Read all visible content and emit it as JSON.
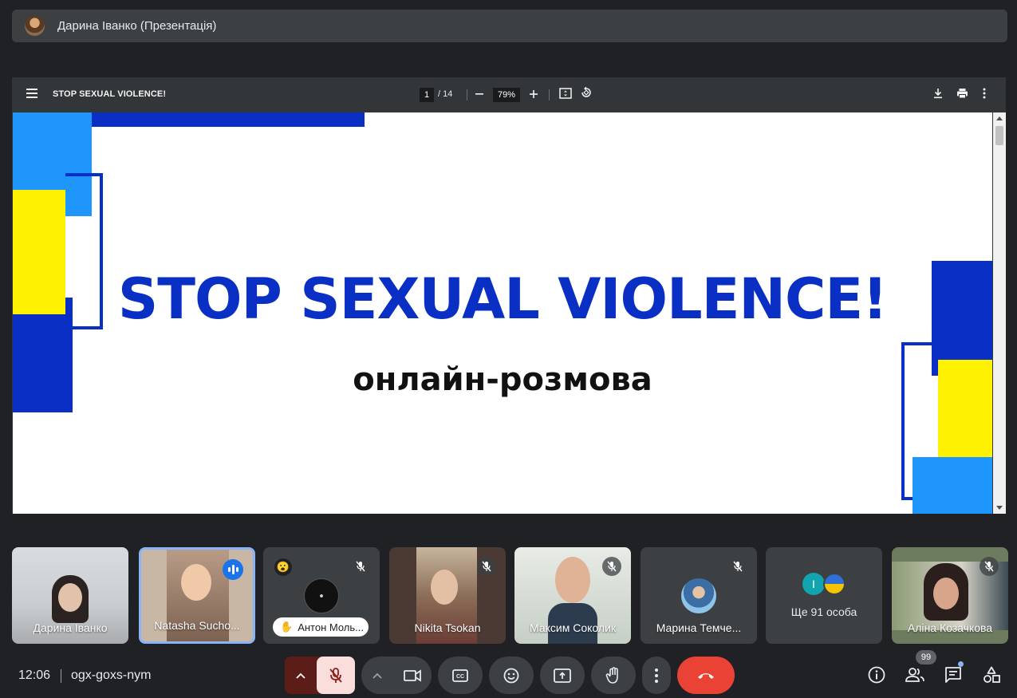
{
  "presenter": {
    "name": "Дарина Іванко (Презентація)"
  },
  "pdf": {
    "title": "STOP SEXUAL VIOLENCE!",
    "page_current": "1",
    "page_total": "/ 14",
    "zoom": "79%",
    "slide_title": "STOP SEXUAL VIOLENCE!",
    "slide_subtitle": "онлайн-розмова"
  },
  "participants": [
    {
      "name": "Дарина Іванко",
      "mic": "on"
    },
    {
      "name": "Natasha Sucho...",
      "mic": "speaking"
    },
    {
      "name": "Антон Моль...",
      "mic": "off",
      "reaction": "😮",
      "hand_raised": true
    },
    {
      "name": "Nikita Tsokan",
      "mic": "off"
    },
    {
      "name": "Максим Соколик",
      "mic": "off"
    },
    {
      "name": "Марина Темче...",
      "mic": "off"
    },
    {
      "name": "Ще 91 особа",
      "initial": "I"
    },
    {
      "name": "Аліна Козачкова",
      "mic": "off"
    }
  ],
  "bottom_bar": {
    "time": "12:06",
    "meeting_code": "ogx-goxs-nym",
    "people_count": "99"
  },
  "colors": {
    "accent": "#1a73e8",
    "end_call": "#ea4335",
    "mic_off_bg": "#f9dedc",
    "slide_blue": "#0a2fc4",
    "slide_yellow": "#fff200",
    "slide_light_blue": "#1e96fc"
  }
}
